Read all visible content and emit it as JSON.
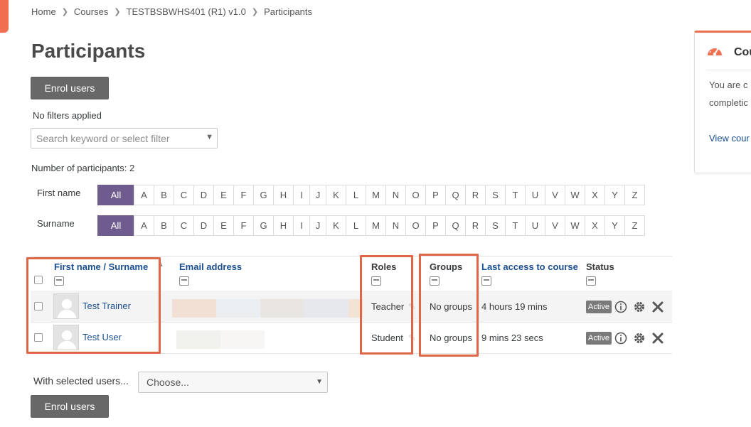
{
  "breadcrumb": [
    "Home",
    "Courses",
    "TESTBSBWHS401 (R1) v1.0",
    "Participants"
  ],
  "page_title": "Participants",
  "enrol_button_label": "Enrol users",
  "filters": {
    "status_text": "No filters applied",
    "search_placeholder": "Search keyword or select filter"
  },
  "participants_count_text": "Number of participants: 2",
  "initials": {
    "first_name_label": "First name",
    "surname_label": "Surname",
    "all_label": "All",
    "letters": [
      "A",
      "B",
      "C",
      "D",
      "E",
      "F",
      "G",
      "H",
      "I",
      "J",
      "K",
      "L",
      "M",
      "N",
      "O",
      "P",
      "Q",
      "R",
      "S",
      "T",
      "U",
      "V",
      "W",
      "X",
      "Y",
      "Z"
    ]
  },
  "table": {
    "headers": {
      "name": "First name / Surname",
      "email": "Email address",
      "roles": "Roles",
      "groups": "Groups",
      "last_access": "Last access to course",
      "status": "Status"
    },
    "rows": [
      {
        "name": "Test Trainer",
        "role": "Teacher",
        "groups": "No groups",
        "last_access": "4 hours 19 mins",
        "status": "Active"
      },
      {
        "name": "Test User",
        "role": "Student",
        "groups": "No groups",
        "last_access": "9 mins 23 secs",
        "status": "Active"
      }
    ]
  },
  "bulk": {
    "label": "With selected users...",
    "select_value": "Choose..."
  },
  "block": {
    "title": "Cou",
    "line1": "You are c",
    "line2": "completic",
    "link": "View cour"
  },
  "colors": {
    "accent": "#f16f51",
    "highlight": "#e06648",
    "initials_active": "#6f5b8e",
    "link": "#1a4f91",
    "button": "#686868"
  }
}
